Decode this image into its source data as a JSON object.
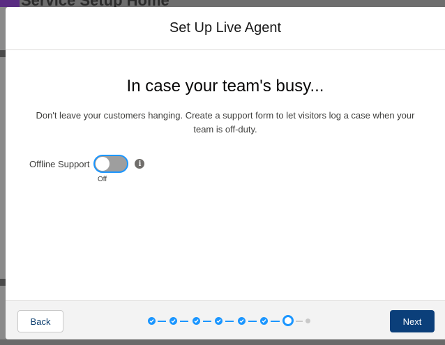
{
  "background": {
    "app_title": "Service Setup Home"
  },
  "modal": {
    "title": "Set Up Live Agent",
    "heading": "In case your team's busy...",
    "description": "Don't leave your customers hanging. Create a support form to let visitors log a case when your team is off-duty.",
    "offline_support": {
      "label": "Offline Support",
      "state_label": "Off",
      "enabled": false,
      "info_icon": "info-icon"
    }
  },
  "footer": {
    "back_label": "Back",
    "next_label": "Next",
    "progress": {
      "total_steps": 8,
      "completed_steps": 6,
      "current_step": 7
    }
  },
  "colors": {
    "primary_button": "#0b3f7a",
    "progress_accent": "#1b96ff",
    "toggle_off": "#9e9e9e"
  }
}
